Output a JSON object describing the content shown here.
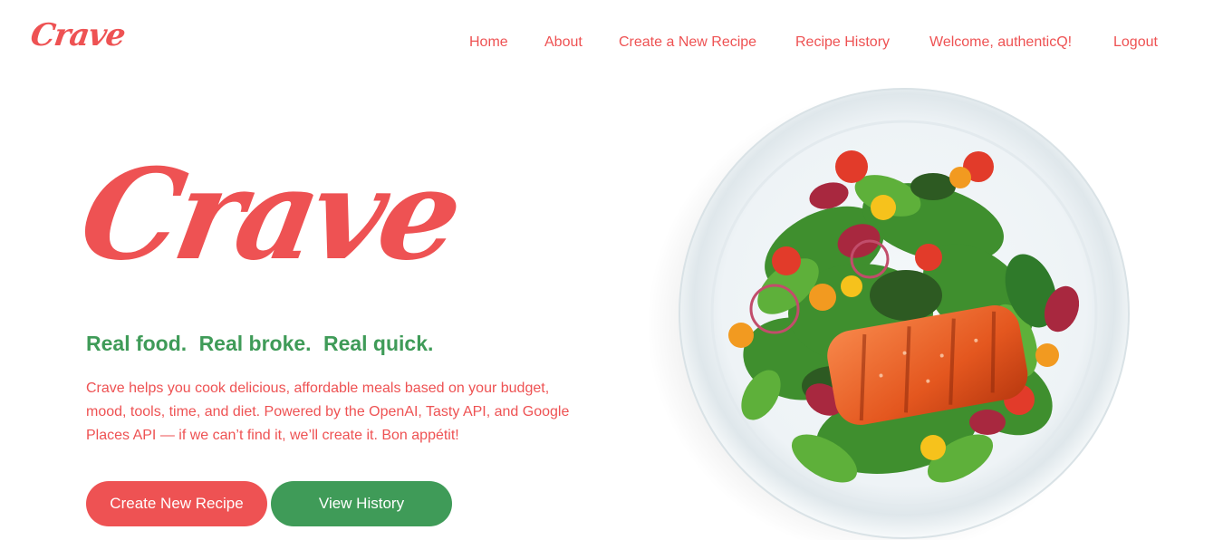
{
  "brand": {
    "name": "Crave"
  },
  "nav": {
    "home": "Home",
    "about": "About",
    "create": "Create a New Recipe",
    "history": "Recipe History",
    "welcome": "Welcome, authenticQ!",
    "logout": "Logout"
  },
  "hero": {
    "title": "Crave",
    "tagline": [
      "Real food.",
      "Real broke.",
      "Real quick."
    ],
    "description": "Crave helps you cook delicious, affordable meals based on your budget, mood, tools, time, and diet. Powered by the OpenAI, Tasty API, and Google Places API — if we can’t find it, we’ll create it. Bon appétit!",
    "create_button": "Create New Recipe",
    "history_button": "View History"
  },
  "colors": {
    "brand_red": "#ee5253",
    "brand_green": "#3f9b58"
  }
}
